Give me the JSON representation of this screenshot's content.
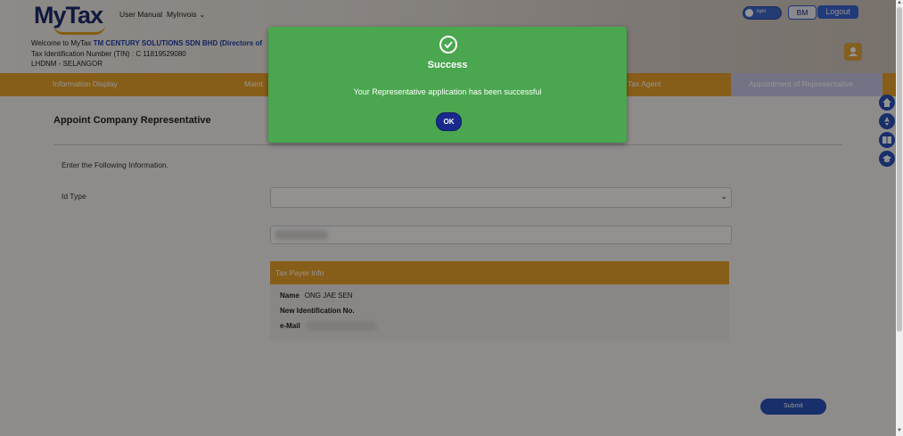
{
  "header": {
    "logo": "MyTax",
    "nav": [
      {
        "label": "User Manual"
      },
      {
        "label": "MyInvois"
      }
    ],
    "theme_toggle_label": "light",
    "lang_button": "BM",
    "logout_button": "Logout",
    "welcome_prefix": "Welcome to MyTax ",
    "company": "TM CENTURY SOLUTIONS SDN BHD (Directors of",
    "tin_line": "Tax Identification Number (TIN) : C 11819529080",
    "branch_line": "LHDNM - SELANGOR"
  },
  "tabs": [
    {
      "label": "Information Display"
    },
    {
      "label": "Maint"
    },
    {
      "label": "Tax Agent"
    },
    {
      "label": "Appointment of Representative"
    }
  ],
  "content": {
    "title": "Appoint Company Representative",
    "instruction": "Enter the Following Information.",
    "id_type_label": "Id Type",
    "taxpayer_header": "Tax Payer Info",
    "taxpayer": {
      "name_label": "Name",
      "name_value": "ONG JAE SEN",
      "new_id_label": "New Identification No.",
      "email_label": "e-Mail"
    },
    "submit_button": "Submit"
  },
  "side_icons": [
    "home-icon",
    "rocket-icon",
    "book-icon",
    "graduation-cap-icon"
  ],
  "modal": {
    "icon": "check-circle-icon",
    "title": "Success",
    "message": "Your Representative application has been successful",
    "ok_button": "OK"
  },
  "colors": {
    "accent_orange": "#e8a22c",
    "primary_blue": "#2a52b8",
    "success_green": "#4aa64f",
    "ok_button": "#1a2a8c"
  }
}
